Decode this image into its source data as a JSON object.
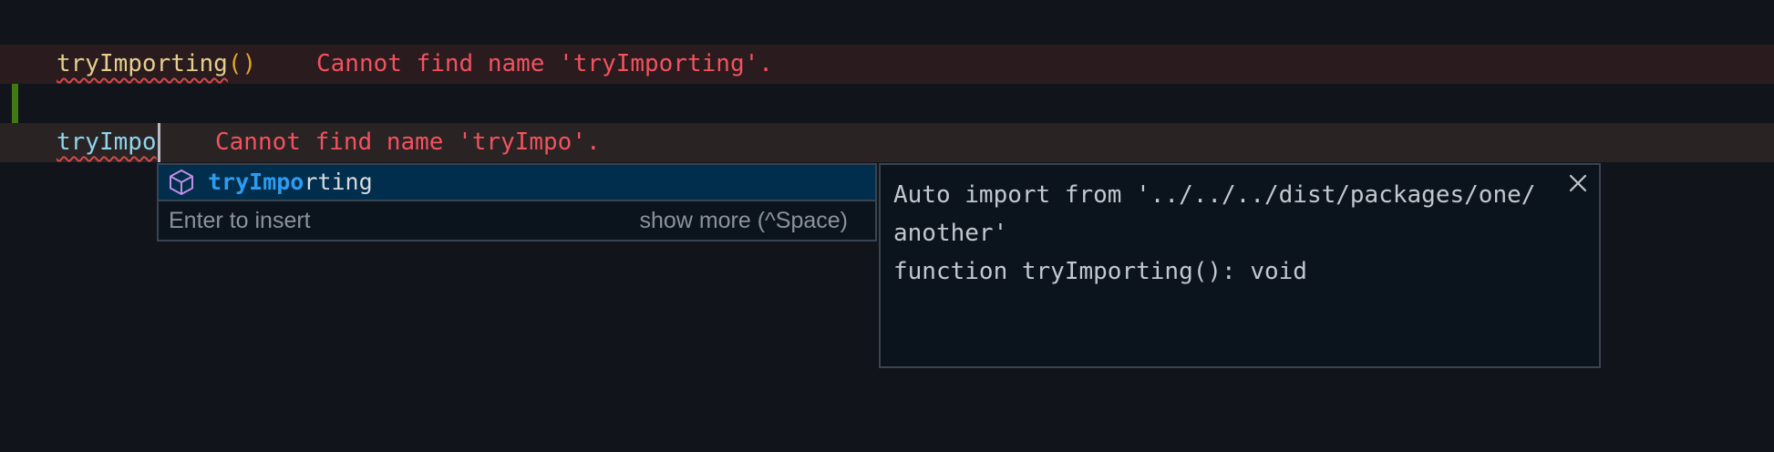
{
  "editor": {
    "line1": {
      "identifier": "tryImporting",
      "parens": "()",
      "error": "Cannot find name 'tryImporting'."
    },
    "line2": {
      "identifier": "tryImpo",
      "error": "Cannot find name 'tryImpo'."
    }
  },
  "suggest": {
    "item": {
      "match": "tryImpo",
      "rest": "rting",
      "icon": "symbol-module-icon"
    },
    "hint": "Enter to insert",
    "show_more": "show more (^Space)"
  },
  "details": {
    "line1": "Auto import from '../../../dist/packages/one/",
    "line2": "another'",
    "line3": "function tryImporting(): void",
    "close_icon": "close-icon"
  },
  "colors": {
    "background": "#11151b",
    "error_text": "#f2525e",
    "error_line_bg": "#2a1b1f",
    "match_highlight": "#2d9cf0",
    "selected_item_bg": "#002e4c",
    "gutter_modified": "#3f7a13"
  }
}
